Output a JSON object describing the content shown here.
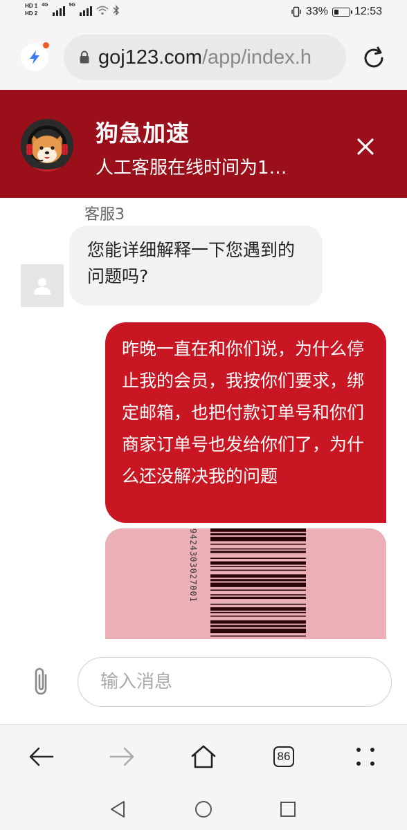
{
  "status_bar": {
    "sim_labels": [
      "HD 1",
      "HD 2"
    ],
    "net1": "4G",
    "net2": "5G",
    "battery_percent": "33%",
    "battery_level": 0.33,
    "time": "12:53"
  },
  "browser": {
    "url_domain": "goj123.com",
    "url_path": "/app/index.h",
    "tab_count": "86"
  },
  "header": {
    "title": "狗急加速",
    "subtitle": "人工客服在线时间为1…"
  },
  "messages": {
    "agent_name": "客服3",
    "agent_text": "您能详细解释一下您遇到的问题吗?",
    "user_text": "昨晚一直在和你们说，为什么停止我的会员，我按你们要求，绑定邮箱，也把付款订单号和你们商家订单号也发给你们了，为什么还没解决我的问题",
    "image_barcode_number": "9424303027001"
  },
  "composer": {
    "placeholder": "输入消息"
  },
  "colors": {
    "header_bg": "#9b0f1a",
    "user_bubble": "#c91623",
    "agent_bubble": "#f2f2f3"
  },
  "icons": [
    "flash-icon",
    "lock-icon",
    "reload-icon",
    "close-icon",
    "avatar-placeholder-icon",
    "paperclip-icon",
    "back-arrow-icon",
    "forward-arrow-icon",
    "home-icon",
    "tabs-icon",
    "more-icon",
    "nav-back-icon",
    "nav-home-icon",
    "nav-recents-icon"
  ]
}
